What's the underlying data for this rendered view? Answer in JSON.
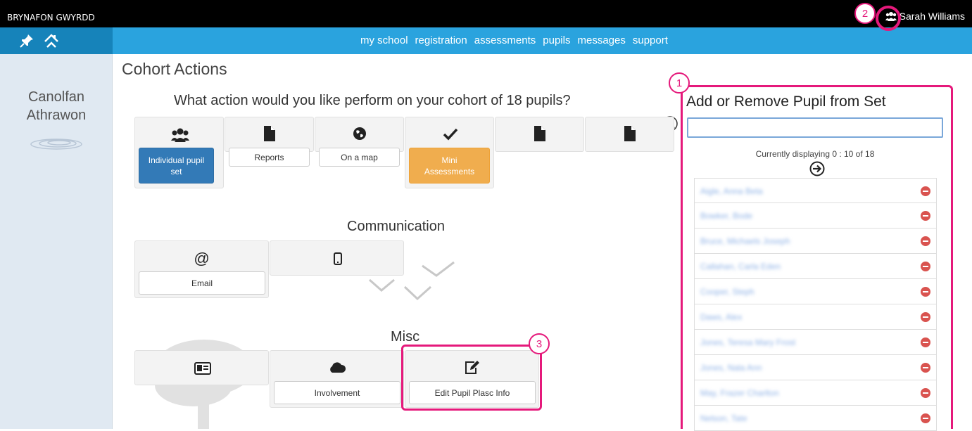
{
  "topbar": {
    "school_name": "BRYNAFON GWYRDD",
    "user_name": "Sarah Williams",
    "user_icon": "users-icon"
  },
  "nav": {
    "left_icons": [
      "pin-icon",
      "home-icon"
    ],
    "links": [
      "my school",
      "registration",
      "assessments",
      "pupils",
      "messages",
      "support"
    ]
  },
  "sidebar": {
    "brand_line1": "Canolfan",
    "brand_line2": "Athrawon",
    "logo_icon": "ripple-logo-icon"
  },
  "main": {
    "title": "Cohort Actions",
    "question": "What action would you like perform on your cohort of 18 pupils?",
    "actions": [
      {
        "icon": "users-icon",
        "label": "Individual pupil set"
      },
      {
        "icon": "document-icon",
        "label": "Reports"
      },
      {
        "icon": "globe-icon",
        "label": "On a map"
      },
      {
        "icon": "checkmark-icon",
        "label": "Mini Assessments"
      },
      {
        "icon": "document-icon",
        "label": ""
      },
      {
        "icon": "document-icon",
        "label": ""
      }
    ],
    "communication_title": "Communication",
    "communication": [
      {
        "icon": "at-icon",
        "label": "Email"
      },
      {
        "icon": "mobile-icon",
        "label": ""
      }
    ],
    "misc_title": "Misc",
    "misc": [
      {
        "icon": "id-card-icon",
        "label": ""
      },
      {
        "icon": "cloud-icon",
        "label": "Involvement"
      },
      {
        "icon": "edit-icon",
        "label": "Edit Pupil Plasc Info"
      }
    ]
  },
  "panel": {
    "title": "Add or Remove Pupil from Set",
    "search_value": "",
    "display_info": "Currently displaying 0 : 10 of 18",
    "pupils": [
      "Aigle, Anna Beta",
      "Bowker, Bode",
      "Bruce, Michaels Joseph",
      "Callahan, Carla Eden",
      "Cooper, Steph",
      "Daws, Alex",
      "Jones, Teresa Mary Frost",
      "Jones, Nala Ann",
      "May, Frazer Charlton",
      "Nelson, Tate"
    ]
  },
  "callouts": [
    "1",
    "2",
    "3"
  ],
  "colors": {
    "nav": "#2aa3de",
    "accent": "#e5197b",
    "primary": "#337ab7",
    "warning": "#f0ad4e",
    "danger": "#d9534f"
  }
}
